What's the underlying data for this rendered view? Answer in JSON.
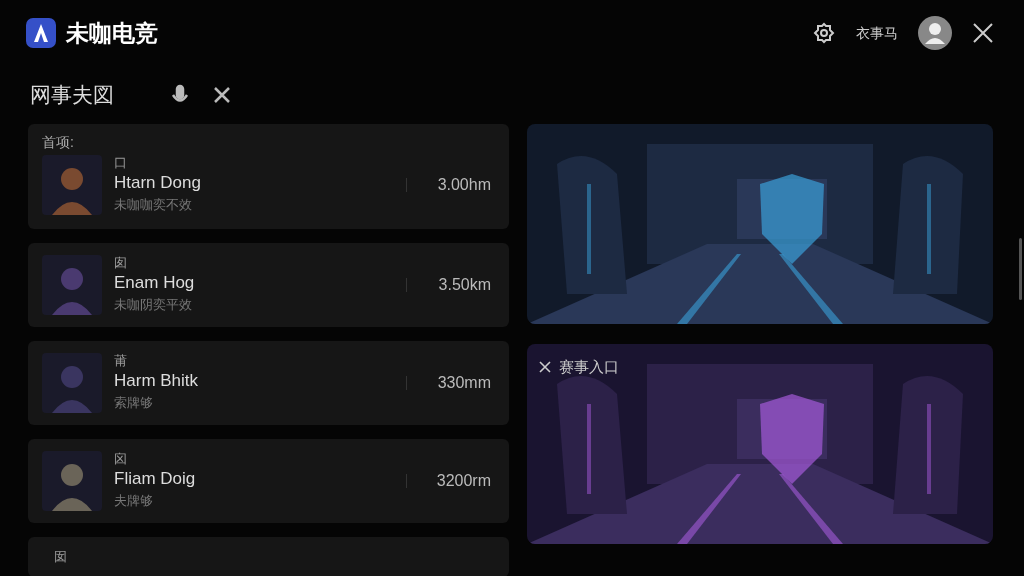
{
  "app": {
    "title": "未咖电竞"
  },
  "header": {
    "user_label": "衣事马"
  },
  "section": {
    "title": "网事夫図"
  },
  "list": {
    "heading": "首项:",
    "rows": [
      {
        "tag": "口",
        "name": "Htarn Dong",
        "subtitle": "未咖咖奕不效",
        "distance": "3.00hm"
      },
      {
        "tag": "囱",
        "name": "Enam Hog",
        "subtitle": "未咖阴奕平效",
        "distance": "3.50km"
      },
      {
        "tag": "莆",
        "name": "Harm Bhitk",
        "subtitle": "索牌够",
        "distance": "330mm"
      },
      {
        "tag": "囟",
        "name": "Fliam Doig",
        "subtitle": "夫牌够",
        "distance": "3200rm"
      },
      {
        "tag": "囡"
      }
    ]
  },
  "banners": [
    {
      "kind": "picture"
    },
    {
      "kind": "picture",
      "overlay_label": "赛事入口"
    }
  ]
}
